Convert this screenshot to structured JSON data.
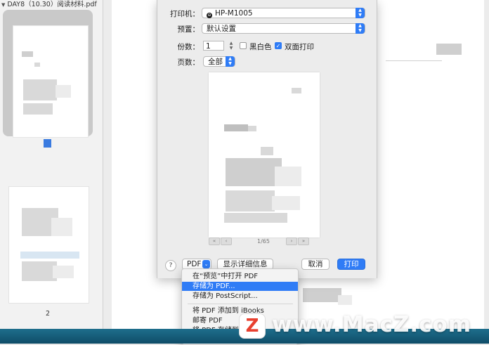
{
  "sidebar": {
    "title": "DAY8（10.30）阅读材料.pdf",
    "page2_number": "2"
  },
  "dialog": {
    "printer_label": "打印机：",
    "printer_value": "HP-M1005",
    "presets_label": "预置：",
    "presets_value": "默认设置",
    "copies_label": "份数：",
    "copies_value": "1",
    "bw_label": "黑白色",
    "bw_checked": false,
    "duplex_label": "双面打印",
    "duplex_checked": true,
    "pages_label": "页数：",
    "pages_value": "全部",
    "page_indicator": "1/65",
    "help_label": "?",
    "pdf_label": "PDF",
    "show_details_label": "显示详细信息",
    "cancel_label": "取消",
    "print_label": "打印"
  },
  "pdf_menu": {
    "items": [
      "在“预览”中打开 PDF",
      "存储为 PDF...",
      "存储为 PostScript...",
      "将 PDF 添加到 iBooks",
      "邮寄 PDF",
      "将 PDF 存储到 iCloud"
    ],
    "highlighted_index": 1
  },
  "watermark": {
    "logo_letter": "Z",
    "text": "www.MacZ.com"
  },
  "colors": {
    "accent": "#2f7cf6",
    "selection_marker": "#3a7be0"
  }
}
